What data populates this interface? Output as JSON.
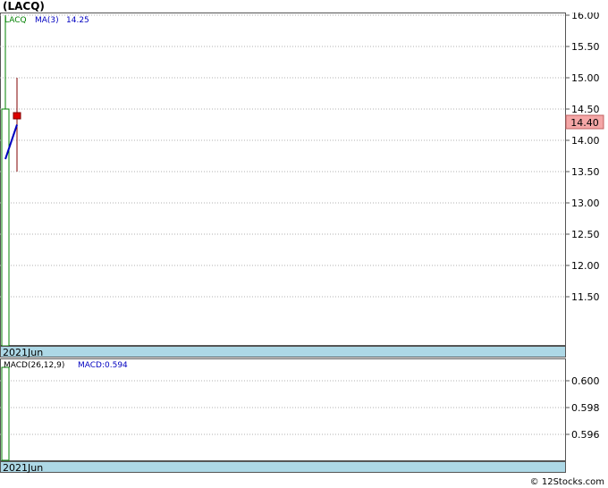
{
  "title": "(LACQ)",
  "footer": "© 12Stocks.com",
  "colors": {
    "axis_bar": "#add8e6",
    "grid": "#b0b0b0",
    "bar_up": "#008000",
    "bar_down": "#800000",
    "ma_line": "#0000c0",
    "price_label_bg": "#f4a6a6",
    "last_marker": "#dd0000"
  },
  "chart_data": [
    {
      "type": "candlestick",
      "legend": {
        "ticker": "LACQ",
        "ma_label": "MA(3)",
        "ma_value": "14.25"
      },
      "xlabel": "2021Jun",
      "yticks": [
        "16.00",
        "15.50",
        "15.00",
        "14.50",
        "14.00",
        "13.50",
        "13.00",
        "12.50",
        "12.00",
        "11.50"
      ],
      "ylim": [
        11.0,
        16.1
      ],
      "last_price_label": "14.40",
      "bars": [
        {
          "open": 14.5,
          "close": 11.0,
          "high": 16.0,
          "low": 11.0,
          "style": "green-open"
        },
        {
          "open": 14.4,
          "close": 14.4,
          "high": 15.0,
          "low": 13.5,
          "style": "red-marker"
        }
      ],
      "ma_line": [
        {
          "i": 0,
          "y": 13.7
        },
        {
          "i": 1,
          "y": 14.25
        }
      ]
    },
    {
      "type": "bar",
      "legend": {
        "label": "MACD(26,12,9)",
        "value_label": "MACD:0.594"
      },
      "xlabel": "2021Jun",
      "yticks": [
        "0.600",
        "0.598",
        "0.596"
      ],
      "ylim": [
        0.5945,
        0.6015
      ],
      "values": [
        0.601
      ]
    }
  ]
}
